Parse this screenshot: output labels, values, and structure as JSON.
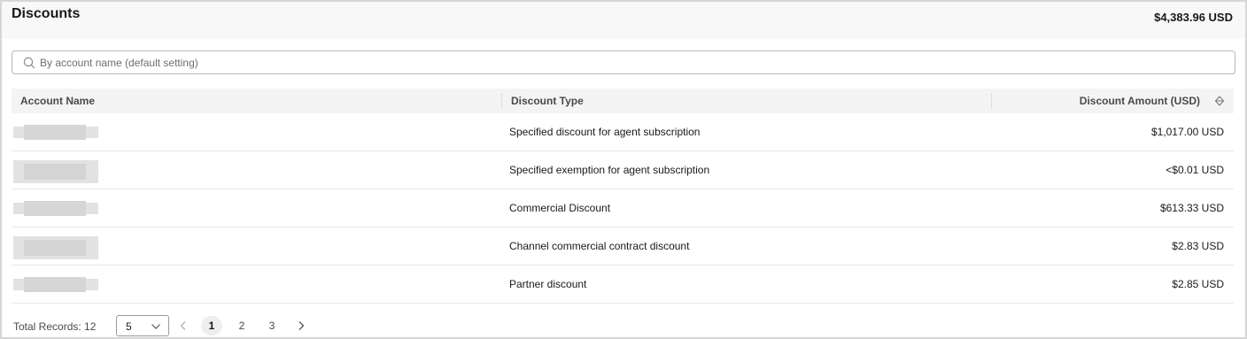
{
  "header": {
    "title": "Discounts",
    "total": "$4,383.96 USD"
  },
  "search": {
    "placeholder": "By account name (default setting)"
  },
  "table": {
    "columns": [
      "Account Name",
      "Discount Type",
      "Discount Amount (USD)"
    ],
    "rows": [
      {
        "type": "Specified discount for agent subscription",
        "amount": "$1,017.00 USD"
      },
      {
        "type": "Specified exemption for agent subscription",
        "amount": "<$0.01 USD"
      },
      {
        "type": "Commercial Discount",
        "amount": "$613.33 USD"
      },
      {
        "type": "Channel commercial contract discount",
        "amount": "$2.83 USD"
      },
      {
        "type": "Partner discount",
        "amount": "$2.85 USD"
      }
    ]
  },
  "footer": {
    "total_records": "Total Records: 12",
    "page_size": "5",
    "pages": [
      "1",
      "2",
      "3"
    ],
    "current_page": "1"
  }
}
